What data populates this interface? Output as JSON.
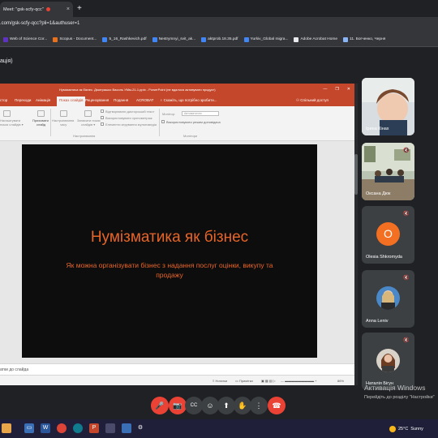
{
  "browser": {
    "tab_title": "Meet: \"gsk-scfy-qcc\"",
    "tab_close": "×",
    "new_tab": "+",
    "address": ".com/gsk-scfy-qcc?pli=1&authuser=1",
    "bookmarks": [
      {
        "label": "Web of Science Cor...",
        "icon": "wos-icon",
        "color": "#5e33bf"
      },
      {
        "label": "Scopus - Document...",
        "icon": "scopus-icon",
        "color": "#e9711c"
      },
      {
        "label": "5_16_Rashkevich.pdf",
        "icon": "pdf-icon",
        "color": "#4285f4"
      },
      {
        "label": "Nestrymnyi_svit_ak...",
        "icon": "pdf-icon",
        "color": "#4285f4"
      },
      {
        "label": "aktprob.18.35.pdf",
        "icon": "pdf-icon",
        "color": "#4285f4"
      },
      {
        "label": "Yurkiv_Global migra...",
        "icon": "pdf-icon",
        "color": "#4285f4"
      },
      {
        "label": "Adobe Acrobat Home",
        "icon": "acrobat-icon",
        "color": "#e8eaed"
      },
      {
        "label": "11. Богченко, Черня",
        "icon": "globe-icon",
        "color": "#8ab4f8"
      }
    ]
  },
  "meet": {
    "header_fragment": "ація)"
  },
  "powerpoint": {
    "title_bar": "Нумізматика як бізнес. Дмитрашко Василь УМм-21-1.pptx - PowerPoint (не вдалося активувати продукт)",
    "tabs": [
      "стор",
      "Переходи",
      "Анімація",
      "Показ слайдів",
      "Рецензування",
      "Подання",
      "ACROBAT",
      "♀ Скажіть, що потрібно зробити..."
    ],
    "active_tab_index": 3,
    "account_label": "Спільний доступ",
    "ribbon": {
      "group1": [
        "Налаштувати",
        "показ слайдів ▾",
        "Приховати",
        "слайд"
      ],
      "group2": [
        "Настроювання",
        "часу",
        "Записати показ",
        "слайдів ▾"
      ],
      "group3": [
        "Відтворювати дикторський текст",
        "Використовувати хронометраж",
        "Елементи керування мультимедіа"
      ],
      "group_label_setup": "Настроювання",
      "monitor_label": "Монітор:",
      "monitor_value": "Автоматично",
      "presenter_view": "Використовувати режим доповідача",
      "group_label_monitors": "Монітори"
    },
    "slide": {
      "title": "Нумізматика як бізнес",
      "subtitle": "Як можна організувати бізнес з надання послуг оцінки, викупу та продажу"
    },
    "notes": "атки до слайда",
    "status": {
      "notes_button": "Нотатки",
      "comments_button": "Примітки",
      "zoom": "86%"
    }
  },
  "participants": [
    {
      "name": "Ірина Кінах",
      "type": "video"
    },
    {
      "name": "Оксана Дюк",
      "type": "video"
    },
    {
      "name": "Olesia Shkromyda",
      "type": "letter",
      "letter": "O",
      "color": "#f36f21"
    },
    {
      "name": "Anna Leniv",
      "type": "photo"
    },
    {
      "name": "Наталія Бігун",
      "type": "photo"
    }
  ],
  "watermark": {
    "line1": "Активація Windows",
    "line2": "Перейдіть до розділу \"Настройки\""
  },
  "controls": [
    {
      "name": "mic-off",
      "icon": "🎤",
      "red": true
    },
    {
      "name": "camera-off",
      "icon": "📷",
      "red": true
    },
    {
      "name": "captions",
      "icon": "CC",
      "red": false
    },
    {
      "name": "emoji",
      "icon": "☺",
      "red": false
    },
    {
      "name": "present",
      "icon": "⬆",
      "red": false
    },
    {
      "name": "raise-hand",
      "icon": "✋",
      "red": false
    },
    {
      "name": "more-options",
      "icon": "⋮",
      "red": false
    },
    {
      "name": "end-call",
      "icon": "☎",
      "red": true
    }
  ],
  "taskbar": {
    "weather_temp": "25°C",
    "weather_desc": "Sunny"
  }
}
